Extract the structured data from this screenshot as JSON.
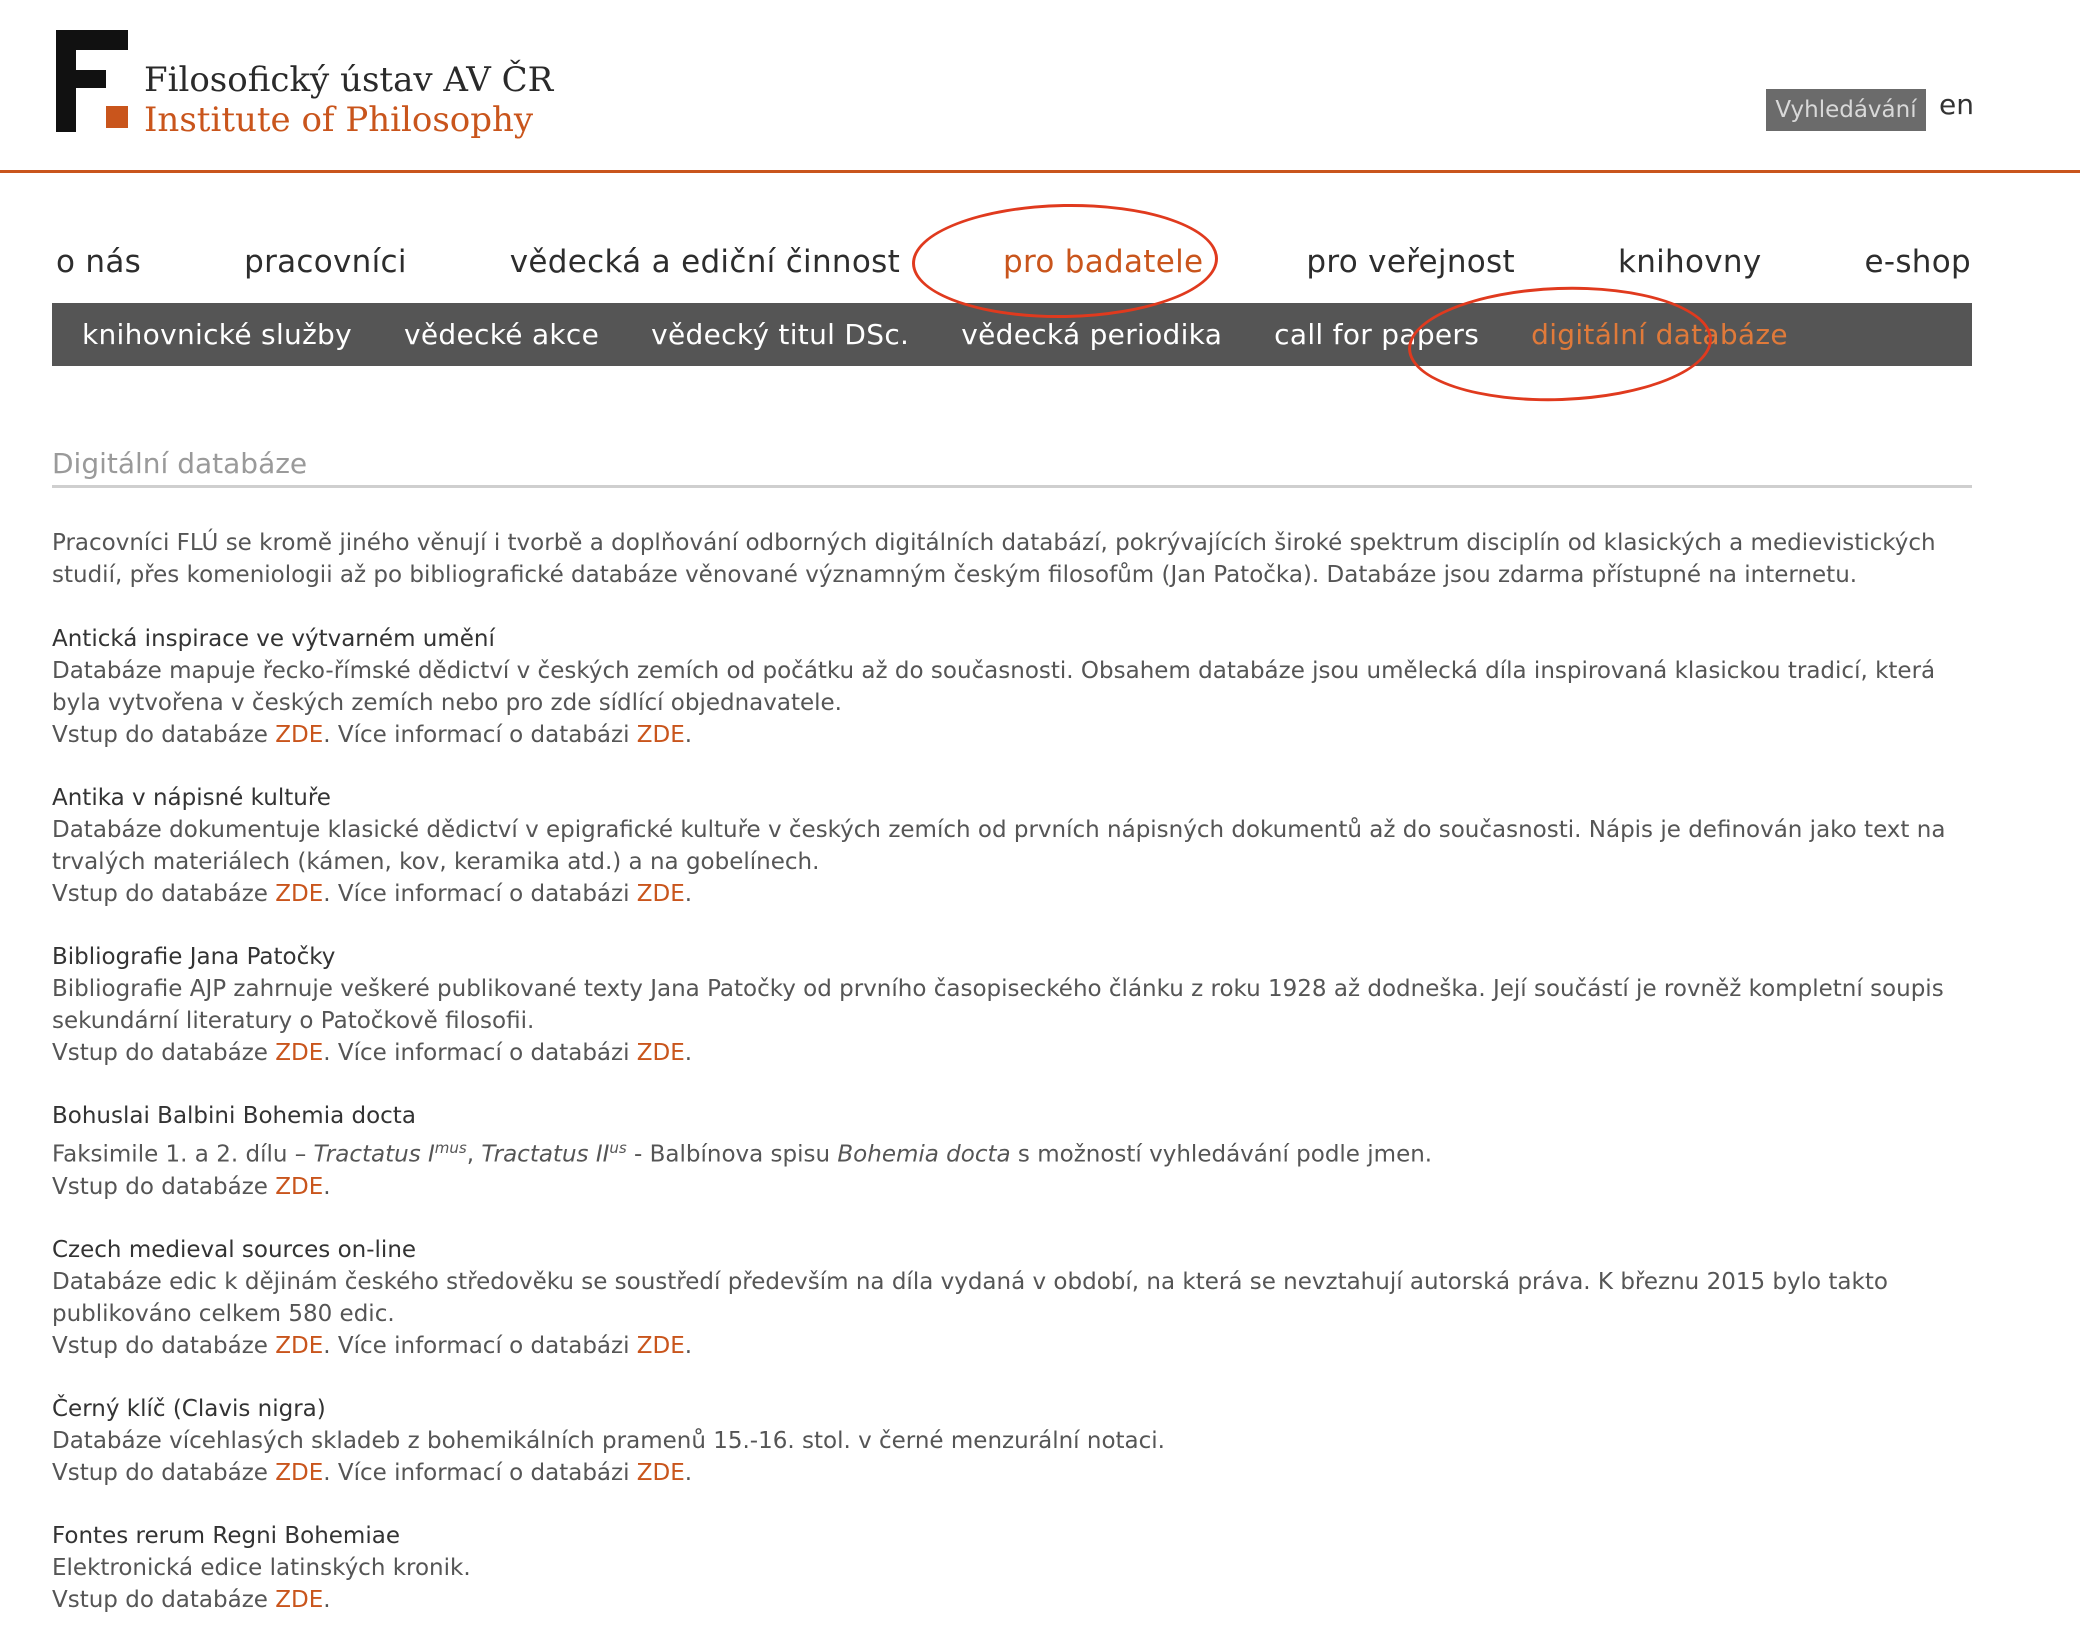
{
  "header": {
    "logo_letter": "F",
    "logo_cs": "Filosofický ústav AV ČR",
    "logo_en": "Institute of Philosophy",
    "search_label": "Vyhledávání",
    "lang_link": "en",
    "accent_color": "#c9551c"
  },
  "main_nav": {
    "items": [
      {
        "label": "o nás"
      },
      {
        "label": "pracovníci"
      },
      {
        "label": "vědecká a ediční činnost"
      },
      {
        "label": "pro badatele",
        "active": true
      },
      {
        "label": "pro veřejnost"
      },
      {
        "label": "knihovny"
      },
      {
        "label": "e-shop"
      }
    ]
  },
  "sub_nav": {
    "items": [
      {
        "label": "knihovnické služby"
      },
      {
        "label": "vědecké akce"
      },
      {
        "label": "vědecký titul DSc."
      },
      {
        "label": "vědecká periodika"
      },
      {
        "label": "call for papers"
      },
      {
        "label": "digitální databáze",
        "active": true
      }
    ]
  },
  "page": {
    "heading": "Digitální databáze",
    "intro": "Pracovníci FLÚ se kromě jiného věnují i tvorbě a doplňování odborných digitálních databází, pokrývajících široké spektrum disciplín od klasických a medievistických studií, přes komeniologii až po bibliografické databáze věnované významným českým filosofům (Jan Patočka). Databáze jsou zdarma přístupné na internetu.",
    "link_prefix": "Vstup do databáze ",
    "link_text": "ZDE",
    "info_prefix": "Více informací o databázi ",
    "period": ".",
    "databases": [
      {
        "title": "Antická inspirace ve výtvarném umění",
        "description": "Databáze mapuje řecko-římské dědictví v českých zemích od počátku až do současnosti. Obsahem databáze jsou umělecká díla inspirovaná klasickou tradicí, která byla vytvořena v českých zemích nebo pro zde sídlící objednavatele."
      },
      {
        "title": "Antika v nápisné kultuře",
        "description": "Databáze dokumentuje klasické dědictví v epigrafické kultuře v českých zemích od prvních nápisných dokumentů až do současnosti. Nápis je definován jako text na trvalých materiálech (kámen, kov, keramika atd.) a na gobelínech."
      },
      {
        "title": "Bibliografie Jana Patočky",
        "description": "Bibliografie AJP zahrnuje veškeré publikované texty Jana Patočky od prvního časopiseckého článku z roku 1928 až dodneška. Její součástí je rovněž kompletní soupis sekundární literatury o Patočkově filosofii."
      },
      {
        "title": "Bohuslai Balbini Bohemia docta",
        "desc_prefix": "Faksimile 1. a 2. dílu – ",
        "work1": "Tractatus I",
        "work1_sup": "mus",
        "sep": ", ",
        "work2": "Tractatus II",
        "work2_sup": "us",
        "mid": " - Balbínova spisu ",
        "work3": "Bohemia docta",
        "desc_suffix": " s možností vyhledávání podle jmen."
      },
      {
        "title": "Czech medieval sources on-line",
        "description": "Databáze edic k dějinám českého středověku se soustředí především na díla vydaná v období, na která se nevztahují autorská práva. K březnu 2015 bylo takto publikováno celkem 580 edic."
      },
      {
        "title": "Černý klíč (Clavis nigra)",
        "description": "Databáze vícehlasých skladeb z bohemikálních pramenů 15.-16. stol. v černé menzurální notaci."
      },
      {
        "title": "Fontes rerum Regni Bohemiae",
        "description": "Elektronická edice latinských kronik."
      }
    ]
  }
}
